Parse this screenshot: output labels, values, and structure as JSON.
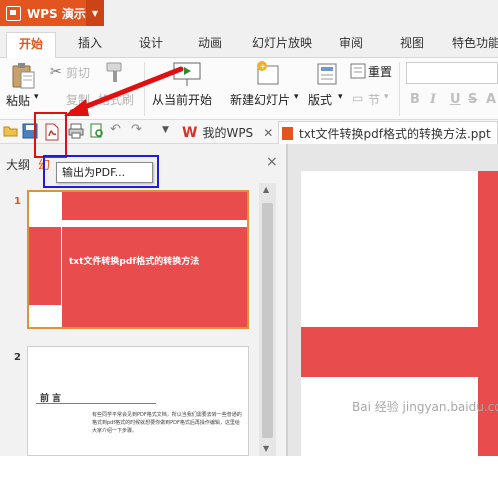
{
  "app": {
    "name": "WPS 演示"
  },
  "tabs": [
    {
      "label": "开始",
      "active": true
    },
    {
      "label": "插入"
    },
    {
      "label": "设计"
    },
    {
      "label": "动画"
    },
    {
      "label": "幻灯片放映"
    },
    {
      "label": "审阅"
    },
    {
      "label": "视图"
    },
    {
      "label": "特色功能"
    }
  ],
  "ribbon": {
    "paste": "粘贴",
    "cut": "剪切",
    "copy": "复制",
    "format_painter": "格式刷",
    "from_current": "从当前开始",
    "new_slide": "新建幻灯片",
    "layout": "版式",
    "reset": "重置",
    "section": "节",
    "bold": "B",
    "italic": "I",
    "underline": "U",
    "strike": "S",
    "shadow": "A"
  },
  "doc_tabs": [
    {
      "label": "我的WPS"
    },
    {
      "label": "txt文件转换pdf格式的转换方法.ppt",
      "active": true
    }
  ],
  "panel": {
    "tab_outline": "大纲",
    "tab_slides": "幻",
    "close": "×"
  },
  "tooltip": "输出为PDF...",
  "slides": [
    {
      "number": "1",
      "title": "txt文件转换pdf格式的转换方法"
    },
    {
      "number": "2",
      "heading": "前言",
      "body": "有些同学平常会见到PDF格式文档，所以当我们需要去转一些普通的格式到pdf格式的时候就想要你做到PDF格式后再操作编辑，这里给大家介绍一下步骤。"
    }
  ],
  "watermark": "Bai 经验 jingyan.baidu.com",
  "colors": {
    "brand": "#e2551f",
    "slide_red": "#e84c4c",
    "highlight_red": "#e01010",
    "highlight_blue": "#1e1ed8"
  }
}
